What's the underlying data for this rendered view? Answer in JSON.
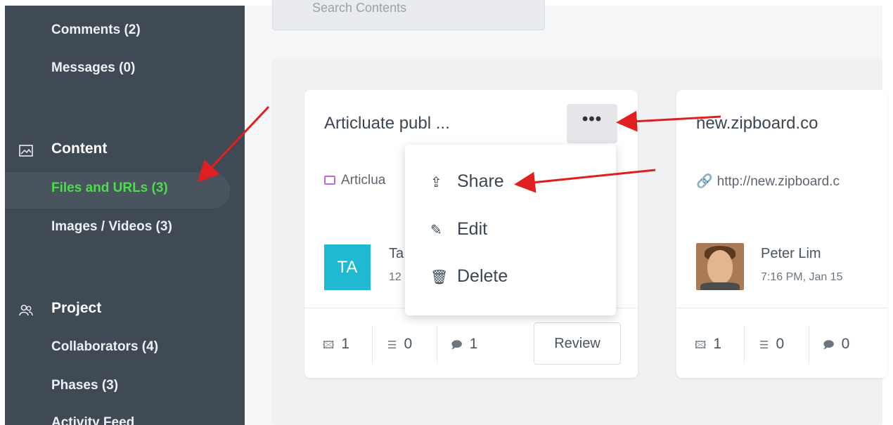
{
  "sidebar": {
    "items": {
      "comments": "Comments (2)",
      "messages": "Messages (0)",
      "files_urls": "Files and URLs (3)",
      "images_videos": "Images / Videos (3)",
      "collaborators": "Collaborators (4)",
      "phases": "Phases (3)",
      "activity_feed": "Activity Feed"
    },
    "sections": {
      "content": "Content",
      "project": "Project"
    },
    "active_color": "#4ade4a"
  },
  "search": {
    "placeholder": "Search Contents"
  },
  "cards": [
    {
      "title": "Articluate publ ...",
      "more_label": "•••",
      "subtitle": "Articlua",
      "avatar_initials": "TA",
      "user_name": "Ta",
      "user_time": "12",
      "stats": {
        "images": "1",
        "tasks": "0",
        "comments": "1"
      },
      "review_label": "Review"
    },
    {
      "title": "new.zipboard.co",
      "subtitle": "http://new.zipboard.c",
      "user_name": "Peter Lim",
      "user_time": "7:16 PM, Jan 15",
      "stats": {
        "images": "1",
        "tasks": "0",
        "comments": "0"
      }
    }
  ],
  "dropdown": {
    "share": "Share",
    "edit": "Edit",
    "delete": "Delete"
  },
  "colors": {
    "sidebar_bg": "#3f4a54",
    "annotation_arrow": "#e02020",
    "avatar_ta": "#20b9d1"
  }
}
